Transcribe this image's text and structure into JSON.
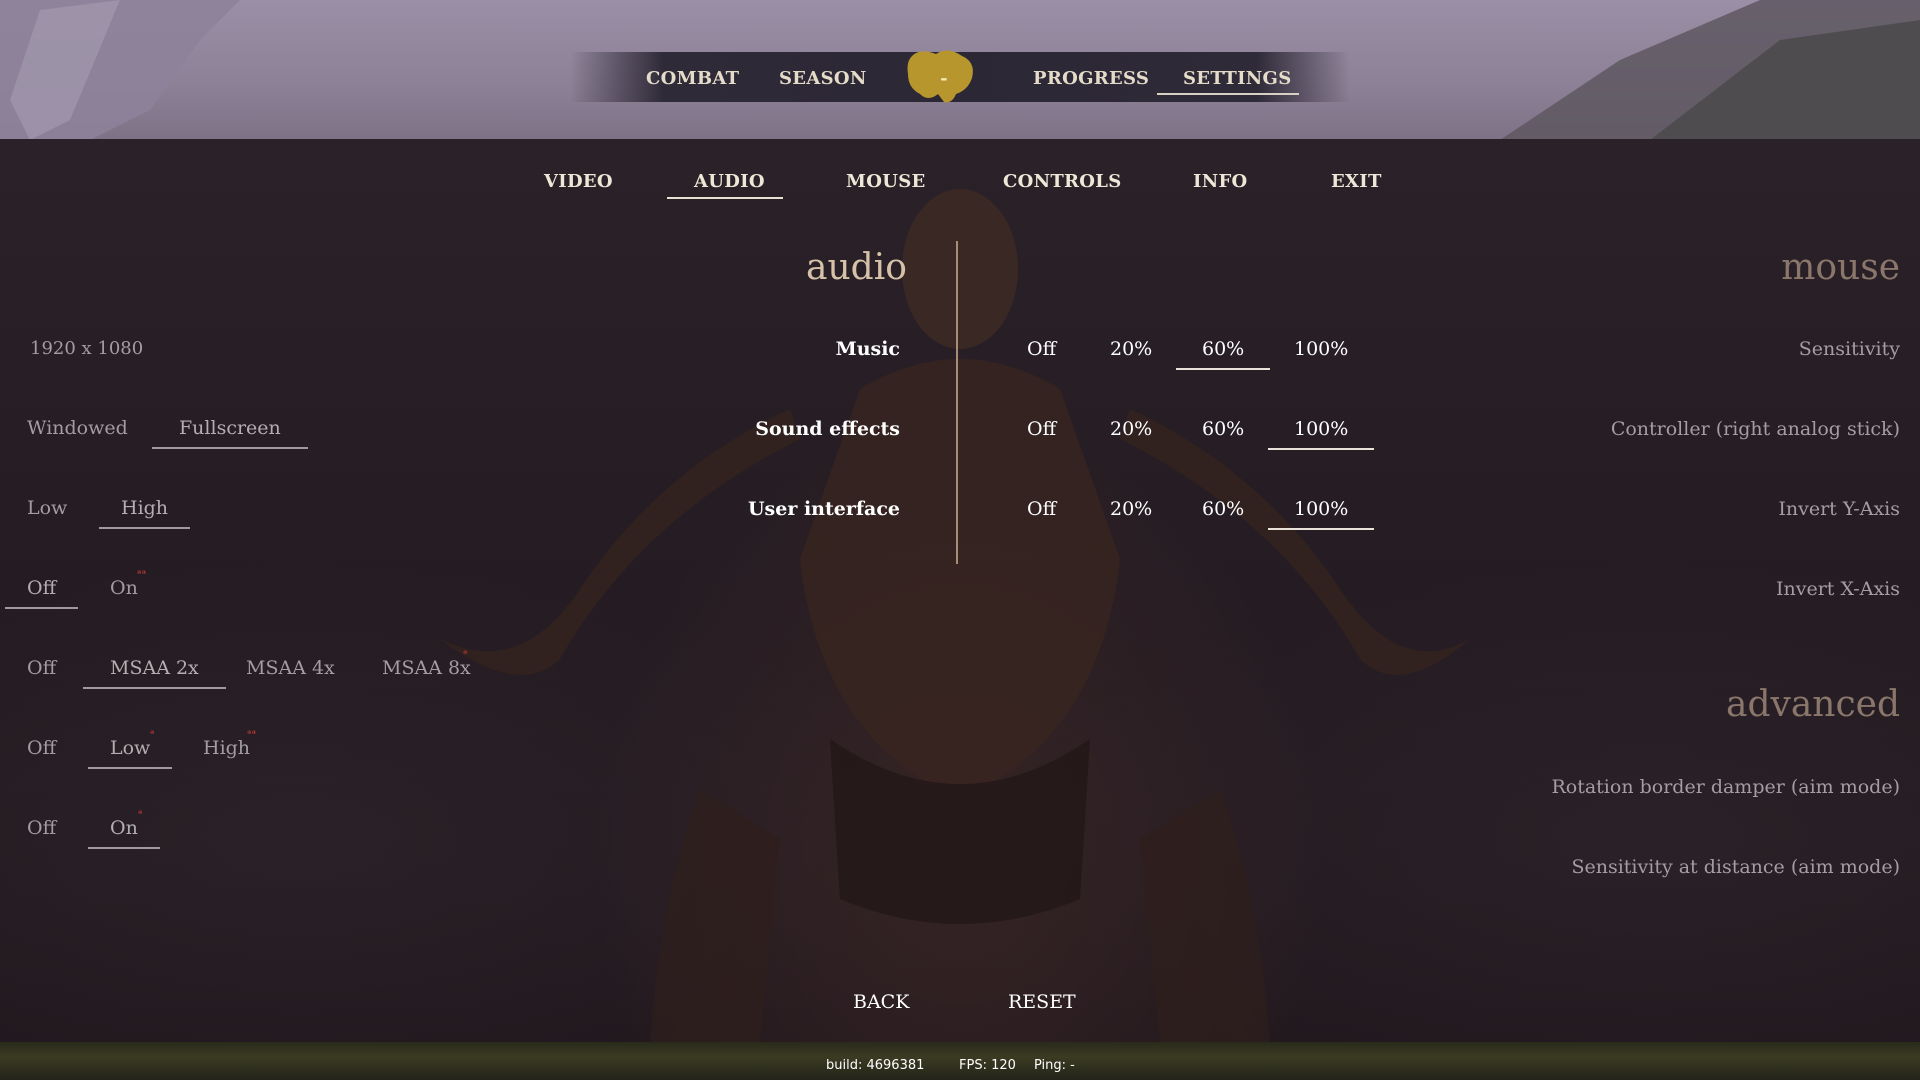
{
  "top_nav": {
    "items": [
      "COMBAT",
      "SEASON",
      "PROGRESS",
      "SETTINGS"
    ],
    "active": "SETTINGS",
    "emblem_mark": "-"
  },
  "sub_tabs": {
    "items": [
      "VIDEO",
      "AUDIO",
      "MOUSE",
      "CONTROLS",
      "INFO",
      "EXIT"
    ],
    "active": "AUDIO"
  },
  "video_panel": {
    "resolution": "1920 x 1080",
    "display_mode": {
      "options": [
        "Windowed",
        "Fullscreen"
      ],
      "selected": "Fullscreen"
    },
    "quality": {
      "options": [
        "Low",
        "High"
      ],
      "selected": "High"
    },
    "toggle_1": {
      "options": [
        "Off",
        "On"
      ],
      "selected": "Off"
    },
    "antialiasing": {
      "options": [
        "Off",
        "MSAA 2x",
        "MSAA 4x",
        "MSAA 8x"
      ],
      "selected": "MSAA 2x"
    },
    "level_setting": {
      "options": [
        "Off",
        "Low",
        "High"
      ],
      "selected": "Low"
    },
    "toggle_2": {
      "options": [
        "Off",
        "On"
      ],
      "selected": "On"
    }
  },
  "audio": {
    "title": "audio",
    "rows": [
      {
        "label": "Music",
        "options": [
          "Off",
          "20%",
          "60%",
          "100%"
        ],
        "selected": "60%",
        "value": 60
      },
      {
        "label": "Sound effects",
        "options": [
          "Off",
          "20%",
          "60%",
          "100%"
        ],
        "selected": "100%",
        "value": 100
      },
      {
        "label": "User interface",
        "options": [
          "Off",
          "20%",
          "60%",
          "100%"
        ],
        "selected": "100%",
        "value": 100
      }
    ]
  },
  "mouse": {
    "title": "mouse",
    "labels": [
      "Sensitivity",
      "Controller (right analog stick)",
      "Invert Y-Axis",
      "Invert X-Axis"
    ]
  },
  "advanced": {
    "title": "advanced",
    "labels": [
      "Rotation border damper (aim mode)",
      "Sensitivity at distance (aim mode)"
    ]
  },
  "buttons": {
    "back": "BACK",
    "reset": "RESET"
  },
  "footer": {
    "build": "build: 4696381",
    "fps": "FPS: 120",
    "ping": "Ping: -"
  },
  "colors": {
    "accent_underline": "#e8e0d2",
    "heading": "#d6c2a8",
    "divider": "#a88c74",
    "emblem": "#b8962e",
    "warning_mark": "#c53a32"
  },
  "icons": {
    "emblem": "clan-emblem-icon"
  }
}
